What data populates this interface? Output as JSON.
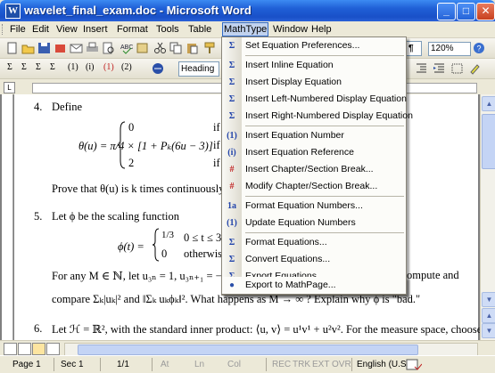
{
  "window": {
    "title": "wavelet_final_exam.doc - Microsoft Word",
    "app_icon": "W"
  },
  "title_buttons": {
    "minimize": "_",
    "maximize": "□",
    "close": "✕"
  },
  "menubar": {
    "items": [
      "File",
      "Edit",
      "View",
      "Insert",
      "Format",
      "Tools",
      "Table",
      "MathType",
      "Window",
      "Help"
    ],
    "active": "MathType",
    "close_glyph": "×"
  },
  "toolbar": {
    "style_value": "Heading",
    "zoom_value": "120%",
    "eq_symbols": [
      "Σ",
      "Σ",
      "Σ",
      "Σ",
      "(1)",
      "(i)",
      "(1)",
      "(2)"
    ]
  },
  "mathtype_menu": {
    "items": [
      {
        "icon": "Σ",
        "label": "Set Equation Preferences..."
      },
      {
        "icon": "Σ",
        "label": "Insert Inline Equation"
      },
      {
        "icon": "Σ",
        "label": "Insert Display Equation"
      },
      {
        "icon": "Σ",
        "label": "Insert Left-Numbered Display Equation"
      },
      {
        "icon": "Σ",
        "label": "Insert Right-Numbered Display Equation"
      },
      {
        "icon": "(1)",
        "label": "Insert Equation Number"
      },
      {
        "icon": "(i)",
        "label": "Insert Equation Reference"
      },
      {
        "icon": "#",
        "label": "Insert Chapter/Section Break..."
      },
      {
        "icon": "#",
        "label": "Modify Chapter/Section Break..."
      },
      {
        "icon": "1a",
        "label": "Format Equation Numbers..."
      },
      {
        "icon": "(1)",
        "label": "Update Equation Numbers"
      },
      {
        "icon": "Σ",
        "label": "Format Equations..."
      },
      {
        "icon": "Σ",
        "label": "Convert Equations..."
      },
      {
        "icon": "Σ",
        "label": "Export Equations..."
      },
      {
        "icon": "●",
        "label": "Export to MathPage..."
      }
    ]
  },
  "document": {
    "q4_number": "4.",
    "q4_text": "Define",
    "theta_lhs": "θ(u) = π/4 × [1 + Pₖ(6u − 3)]",
    "theta_cases": [
      "0",
      "1 + Pₖ(6u − 3)]",
      "2"
    ],
    "theta_conditions": [
      "if",
      "if",
      "if"
    ],
    "prove_text": "Prove that θ(u) is k times continuously",
    "q5_number": "5.",
    "q5_text": "Let ϕ be the scaling function",
    "phi_lhs": "ϕ(t) =",
    "phi_cases": [
      "1/3",
      "0"
    ],
    "phi_conditions": [
      "0 ≤ t ≤ 3",
      "otherwise."
    ],
    "formany_text": "For any M ∈ ℕ, let u₃ₙ = 1, u₃ₙ₊₁ = −1, u₃ₙ₊₂ = 0 ...",
    "formany_tail": "ompute and",
    "compare_text": "compare Σₖ|uₖ|² and ‖Σₖ uₖϕₖ‖². What happens as M → ∞ ? Explain why ϕ is \"bad.\"",
    "q6_number": "6.",
    "q6_text": "Let ℋ = ℝ², with the standard inner product: ⟨u, v⟩ = u¹v¹ + u²v². For the measure space, choose"
  },
  "statusbar": {
    "page": "Page  1",
    "sec": "Sec  1",
    "pages": "1/1",
    "at": "At",
    "ln": "Ln",
    "col": "Col",
    "modes": [
      "REC",
      "TRK",
      "EXT",
      "OVR"
    ],
    "language": "English (U.S"
  }
}
